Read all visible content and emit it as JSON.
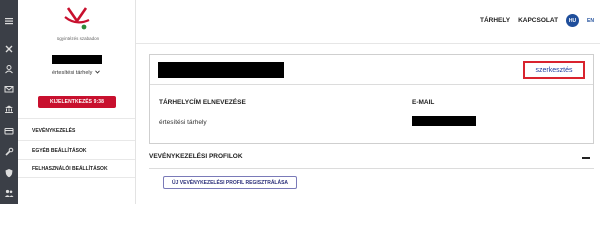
{
  "brand": {
    "logo_text": "ügyintézés szabadon"
  },
  "sidebar": {
    "storage_select": "értesítési tárhely",
    "logout_button": "KIJELENTKEZÉS 9:38",
    "items": [
      {
        "label": "VEVÉNYKEZELÉS"
      },
      {
        "label": "EGYÉB BEÁLLÍTÁSOK"
      },
      {
        "label": "FELHASZNÁLÓI BEÁLLÍTÁSOK"
      }
    ]
  },
  "rail_icons": [
    "menu-icon",
    "tools-icon",
    "user-icon",
    "mail-icon",
    "bank-icon",
    "card-icon",
    "wrench-icon",
    "shield-icon",
    "people-icon"
  ],
  "topnav": {
    "storage": "TÁRHELY",
    "contact": "KAPCSOLAT",
    "lang_active": "HU",
    "lang_other": "EN"
  },
  "card": {
    "edit_link": "szerkesztés",
    "col1_header": "TÁRHELYCÍM ELNEVEZÉSE",
    "col1_value": "értesítési tárhely",
    "col2_header": "E-MAIL"
  },
  "section": {
    "title": "VEVÉNYKEZELÉSI PROFILOK",
    "register_button": "ÚJ VEVÉNYKEZELÉSI PROFIL REGISZTRÁLÁSA"
  },
  "colors": {
    "accent_red": "#c8102e",
    "rail_bg": "#3b3f47",
    "link_blue": "#1f3fa0",
    "highlight_red": "#d9232e"
  }
}
